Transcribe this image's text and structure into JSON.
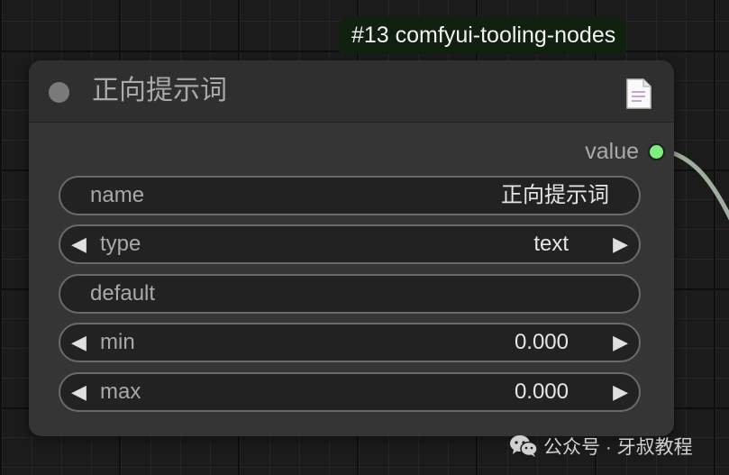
{
  "badge": {
    "text": "#13 comfyui-tooling-nodes"
  },
  "node": {
    "title": "正向提示词",
    "header_icon": "document-icon",
    "output": {
      "label": "value",
      "color": "#7cf07c"
    },
    "widgets": {
      "name": {
        "label": "name",
        "value": "正向提示词"
      },
      "type": {
        "label": "type",
        "value": "text"
      },
      "default": {
        "label": "default",
        "value": ""
      },
      "min": {
        "label": "min",
        "value": "0.000"
      },
      "max": {
        "label": "max",
        "value": "0.000"
      }
    },
    "arrows": {
      "left": "◀",
      "right": "▶"
    }
  },
  "watermark": {
    "icon": "wechat-icon",
    "text": "公众号 · 牙叔教程"
  },
  "colors": {
    "canvas_bg": "#1b1b1b",
    "node_bg": "#353535",
    "badge_bg": "#10220f",
    "wire": "#a9b5a9"
  }
}
